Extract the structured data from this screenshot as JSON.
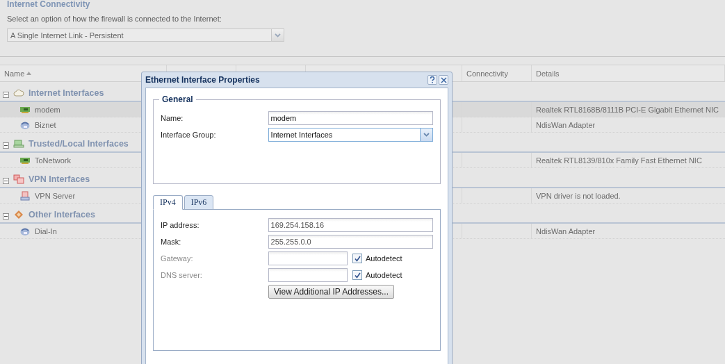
{
  "connectivity": {
    "legend": "Internet Connectivity",
    "prompt": "Select an option of how the firewall is connected to the Internet:",
    "mode": "A Single Internet Link - Persistent"
  },
  "table": {
    "columns": [
      {
        "kind": "label",
        "label": "Name",
        "sorted": true
      },
      {
        "kind": "blank"
      },
      {
        "kind": "blank"
      },
      {
        "kind": "blank"
      },
      {
        "kind": "label",
        "label": "Connectivity"
      },
      {
        "kind": "label",
        "label": "Details"
      }
    ],
    "groups": [
      {
        "name": "Internet Interfaces",
        "kind": "cloud",
        "expanded": true,
        "children": [
          {
            "name": "modem",
            "kind": "nic",
            "selected": true,
            "details": "Realtek RTL8168B/8111B PCI-E Gigabit Ethernet NIC"
          },
          {
            "name": "Biznet",
            "kind": "dialup",
            "selected": false,
            "details": "NdisWan Adapter"
          }
        ]
      },
      {
        "name": "Trusted/Local Interfaces",
        "kind": "trusted",
        "expanded": true,
        "children": [
          {
            "name": "ToNetwork",
            "kind": "nic",
            "selected": false,
            "details": "Realtek RTL8139/810x Family Fast Ethernet NIC"
          }
        ]
      },
      {
        "name": "VPN Interfaces",
        "kind": "vpn",
        "expanded": true,
        "children": [
          {
            "name": "VPN Server",
            "kind": "vpnserver",
            "selected": false,
            "details": "VPN driver is not loaded."
          }
        ]
      },
      {
        "name": "Other Interfaces",
        "kind": "other",
        "expanded": true,
        "children": [
          {
            "name": "Dial-In",
            "kind": "dialup",
            "selected": false,
            "details": "NdisWan Adapter"
          }
        ]
      }
    ]
  },
  "dialog": {
    "title": "Ethernet Interface Properties",
    "general": {
      "legend": "General",
      "fields": [
        {
          "kind": "text",
          "label": "Name:",
          "value": "modem"
        },
        {
          "kind": "select",
          "label": "Interface Group:",
          "value": "Internet Interfaces"
        }
      ]
    },
    "tabs": [
      {
        "label": "IPv4",
        "selected": true
      },
      {
        "label": "IPv6",
        "selected": false
      }
    ],
    "ipv4": {
      "fields": [
        {
          "label": "IP address:",
          "value": "169.254.158.16",
          "disabled": false,
          "readonly": true
        },
        {
          "label": "Mask:",
          "value": "255.255.0.0",
          "disabled": false,
          "readonly": true
        },
        {
          "label": "Gateway:",
          "disabled": true,
          "readonly": false,
          "autodetect": {
            "label": "Autodetect",
            "checked": true
          }
        },
        {
          "label": "DNS server:",
          "disabled": true,
          "readonly": false,
          "autodetect": {
            "label": "Autodetect",
            "checked": true
          }
        }
      ],
      "button": "View Additional IP Addresses..."
    }
  }
}
